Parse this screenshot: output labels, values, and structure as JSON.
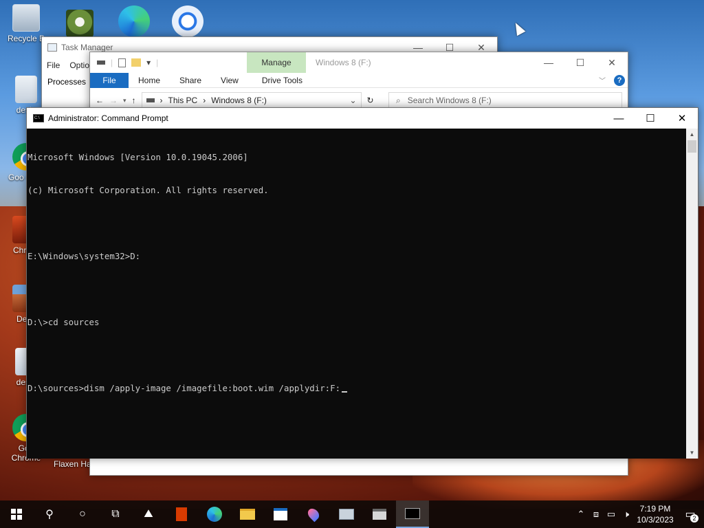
{
  "desktop": {
    "icons": [
      {
        "label": "Recycle Bin",
        "visible": "Recycle B"
      },
      {
        "label": "desktop",
        "visible": "deskt"
      },
      {
        "label": "Google Chrome",
        "visible": "Goo Chro"
      },
      {
        "label": "Chrysanthemum",
        "visible": "Chrysa"
      },
      {
        "label": "Desert",
        "visible": "Dese"
      },
      {
        "label": "desktop",
        "visible": "deskt"
      },
      {
        "label": "Google Chrome",
        "visible_line1": "Goo",
        "visible_line2": "Chrome"
      },
      {
        "label": "Flaxen Hair",
        "visible": "Flaxen Hai"
      }
    ]
  },
  "task_manager": {
    "title": "Task Manager",
    "menu": [
      "File",
      "Optio"
    ],
    "tab": "Processes"
  },
  "file_explorer": {
    "title": "Windows 8 (F:)",
    "contextual_tab": "Manage",
    "ribbon_tabs": [
      "File",
      "Home",
      "Share",
      "View",
      "Drive Tools"
    ],
    "address": {
      "segments": [
        "This PC",
        "Windows 8 (F:)"
      ]
    },
    "search_placeholder": "Search Windows 8 (F:)"
  },
  "command_prompt": {
    "title": "Administrator: Command Prompt",
    "lines": [
      "Microsoft Windows [Version 10.0.19045.2006]",
      "(c) Microsoft Corporation. All rights reserved.",
      "",
      "E:\\Windows\\system32>D:",
      "",
      "D:\\>cd sources",
      "",
      "D:\\sources>dism /apply-image /imagefile:boot.wim /applydir:F:"
    ]
  },
  "taskbar": {
    "time": "7:19 PM",
    "date": "10/3/2023",
    "notification_count": "2",
    "pinned": [
      "start",
      "search",
      "cortana",
      "task-view",
      "photos",
      "office",
      "edge",
      "file-explorer",
      "app",
      "maps",
      "app2",
      "app3",
      "command-prompt"
    ]
  }
}
